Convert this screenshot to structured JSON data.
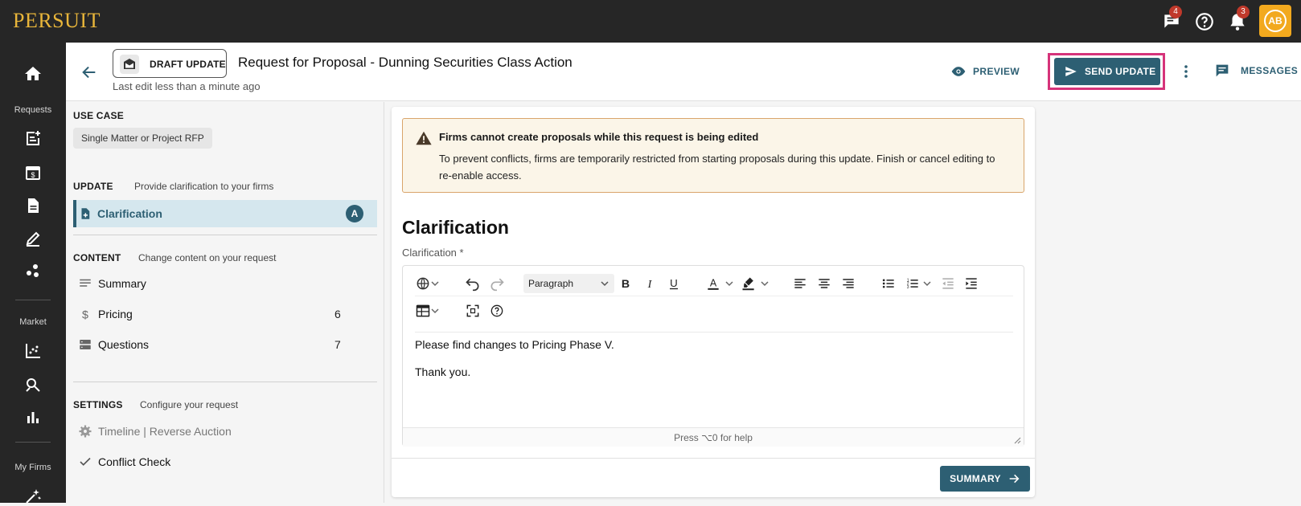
{
  "app": {
    "logo": "PERSUIT"
  },
  "topbar": {
    "chat_badge": "4",
    "notif_badge": "3",
    "avatar_initials": "AB",
    "icons": [
      "chat-icon",
      "help-icon",
      "bell-icon"
    ]
  },
  "rail": {
    "labels": {
      "requests": "Requests",
      "market": "Market",
      "my_firms": "My Firms"
    },
    "icons": [
      "home-icon",
      "new-request-icon",
      "calendar-dollar-icon",
      "document-icon",
      "edit-icon",
      "network-icon",
      "scatter-chart-icon",
      "search-analytics-icon",
      "bar-chart-icon",
      "sparkle-icon"
    ]
  },
  "header": {
    "draft_chip": "DRAFT UPDATE",
    "title": "Request for Proposal - Dunning Securities Class Action",
    "last_edit": "Last edit less than a minute ago",
    "preview": "PREVIEW",
    "send_update": "SEND UPDATE",
    "messages": "MESSAGES"
  },
  "side": {
    "use_case": {
      "heading": "USE CASE",
      "chip": "Single Matter or Project RFP"
    },
    "update": {
      "heading": "UPDATE",
      "sub": "Provide clarification to your firms",
      "items": [
        {
          "label": "Clarification",
          "badge": "A"
        }
      ]
    },
    "content": {
      "heading": "CONTENT",
      "sub": "Change content on your request",
      "items": [
        {
          "label": "Summary",
          "count": ""
        },
        {
          "label": "Pricing",
          "count": "6"
        },
        {
          "label": "Questions",
          "count": "7"
        }
      ]
    },
    "settings": {
      "heading": "SETTINGS",
      "sub": "Configure your request",
      "items": [
        {
          "label": "Timeline | Reverse Auction"
        },
        {
          "label": "Conflict Check"
        }
      ]
    }
  },
  "main": {
    "warning": {
      "title": "Firms cannot create proposals while this request is being edited",
      "body": "To prevent conflicts, firms are temporarily restricted from starting proposals during this update. Finish or cancel editing to re-enable access."
    },
    "heading": "Clarification",
    "field_label": "Clarification *",
    "editor": {
      "block_format": "Paragraph",
      "lines": [
        "Please find changes to Pricing Phase V.",
        "Thank you."
      ],
      "help": "Press ⌥0 for help"
    },
    "summary_button": "SUMMARY"
  },
  "colors": {
    "accent": "#2d5f73",
    "highlight": "#d6337a",
    "logo": "#e8b53a",
    "avatar": "#f2a91e",
    "warning_bg": "#fbf5e8"
  }
}
